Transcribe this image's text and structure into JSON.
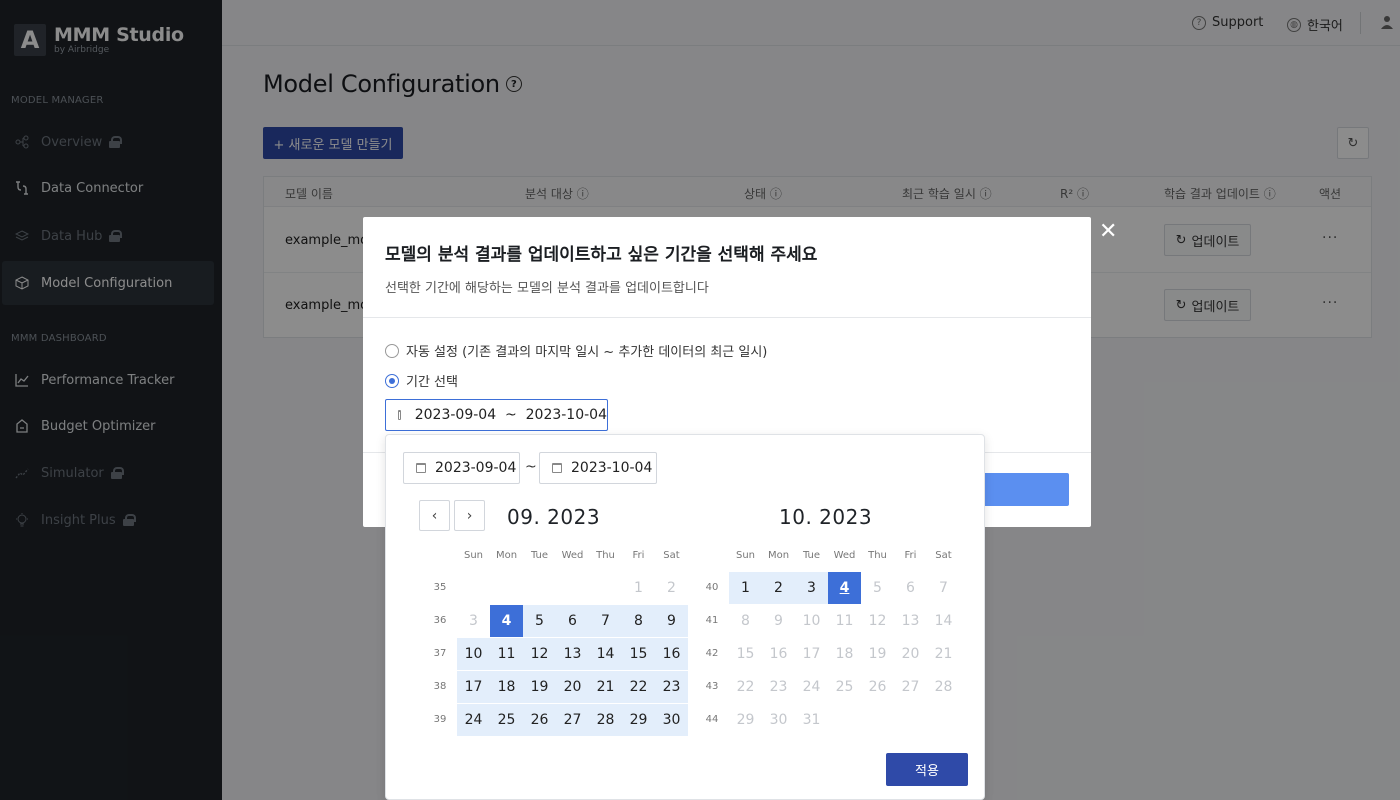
{
  "app": {
    "logo_letter": "A",
    "title": "MMM Studio",
    "subtitle": "by Airbridge"
  },
  "sidebar": {
    "sections": [
      {
        "label": "MODEL MANAGER"
      },
      {
        "label": "MMM DASHBOARD"
      }
    ],
    "items": [
      {
        "label": "Overview",
        "icon": "flow-icon",
        "locked": true
      },
      {
        "label": "Data Connector",
        "icon": "connector-icon",
        "locked": false
      },
      {
        "label": "Data Hub",
        "icon": "stack-icon",
        "locked": true
      },
      {
        "label": "Model Configuration",
        "icon": "cube-icon",
        "locked": false,
        "active": true
      },
      {
        "label": "Performance Tracker",
        "icon": "chart-icon",
        "locked": false
      },
      {
        "label": "Budget Optimizer",
        "icon": "house-icon",
        "locked": false
      },
      {
        "label": "Simulator",
        "icon": "trend-icon",
        "locked": true
      },
      {
        "label": "Insight Plus",
        "icon": "bulb-icon",
        "locked": true
      }
    ]
  },
  "topbar": {
    "support": "Support",
    "language": "한국어"
  },
  "page": {
    "title": "Model Configuration",
    "new_model_button": "+  새로운 모델 만들기"
  },
  "table": {
    "headers": [
      "모델 이름",
      "분석 대상 ⓘ",
      "상태 ⓘ",
      "최근 학습 일시 ⓘ",
      "R² ⓘ",
      "학습 결과 업데이트 ⓘ",
      "액션"
    ],
    "rows": [
      {
        "name": "example_mod",
        "update": "업데이트",
        "action": "···"
      },
      {
        "name": "example_mod",
        "update": "업데이트",
        "action": "···"
      }
    ]
  },
  "modal": {
    "title": "모델의 분석 결과를 업데이트하고 싶은 기간을 선택해 주세요",
    "subtitle": "선택한 기간에 해당하는 모델의 분석 결과를 업데이트합니다",
    "options": [
      {
        "label": "자동 설정 (기존 결과의 마지막 일시 ~ 추가한 데이터의 최근 일시)",
        "selected": false
      },
      {
        "label": "기간 선택",
        "selected": true
      }
    ],
    "range_value": "2023-09-04  ~  2023-10-04",
    "close": "✕"
  },
  "datepicker": {
    "start": "2023-09-04",
    "end": "2023-10-04",
    "tilde": "~",
    "weekdays": [
      "Sun",
      "Mon",
      "Tue",
      "Wed",
      "Thu",
      "Fri",
      "Sat"
    ],
    "left_month": "09. 2023",
    "right_month": "10. 2023",
    "apply": "적용",
    "prev": "‹",
    "next": "›"
  }
}
